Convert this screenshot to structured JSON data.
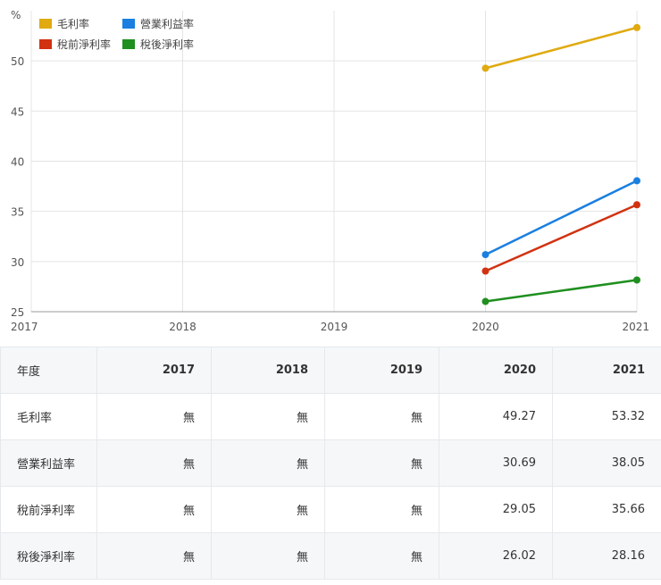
{
  "chart_data": {
    "type": "line",
    "ylabel": "%",
    "x": [
      "2017",
      "2018",
      "2019",
      "2020",
      "2021"
    ],
    "ylim": [
      25,
      55
    ],
    "yticks": [
      25,
      30,
      35,
      40,
      45,
      50
    ],
    "grid": true,
    "legend_position": "top-left",
    "series": [
      {
        "name": "毛利率",
        "color": "#e0aa10",
        "values": [
          null,
          null,
          null,
          49.27,
          53.32
        ]
      },
      {
        "name": "營業利益率",
        "color": "#1a7fe0",
        "values": [
          null,
          null,
          null,
          30.69,
          38.05
        ]
      },
      {
        "name": "稅前淨利率",
        "color": "#d13212",
        "values": [
          null,
          null,
          null,
          29.05,
          35.66
        ]
      },
      {
        "name": "稅後淨利率",
        "color": "#1f8f1f",
        "values": [
          null,
          null,
          null,
          26.02,
          28.16
        ]
      }
    ]
  },
  "table": {
    "header_label": "年度",
    "columns": [
      "2017",
      "2018",
      "2019",
      "2020",
      "2021"
    ],
    "rows": [
      {
        "label": "毛利率",
        "cells": [
          "無",
          "無",
          "無",
          "49.27",
          "53.32"
        ]
      },
      {
        "label": "營業利益率",
        "cells": [
          "無",
          "無",
          "無",
          "30.69",
          "38.05"
        ]
      },
      {
        "label": "稅前淨利率",
        "cells": [
          "無",
          "無",
          "無",
          "29.05",
          "35.66"
        ]
      },
      {
        "label": "稅後淨利率",
        "cells": [
          "無",
          "無",
          "無",
          "26.02",
          "28.16"
        ]
      }
    ]
  }
}
